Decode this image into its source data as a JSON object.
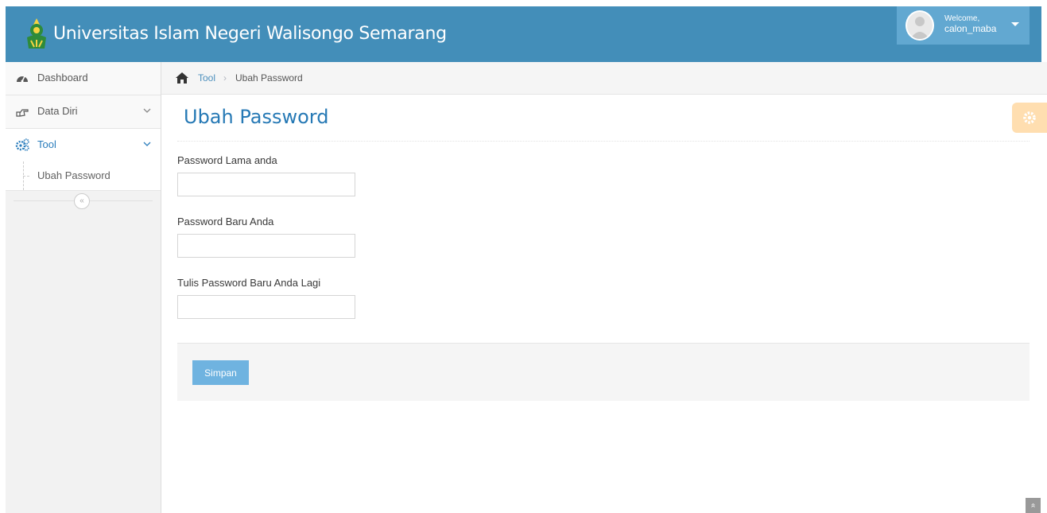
{
  "header": {
    "title": "Universitas Islam Negeri Walisongo Semarang",
    "welcome": "Welcome,",
    "username": "calon_maba"
  },
  "sidebar": {
    "items": [
      {
        "label": "Dashboard",
        "icon": "tachometer-icon"
      },
      {
        "label": "Data Diri",
        "icon": "hand-pointer-icon"
      },
      {
        "label": "Tool",
        "icon": "cogs-icon"
      }
    ],
    "submenu": [
      {
        "label": "Ubah Password"
      }
    ],
    "collapse_glyph": "«"
  },
  "breadcrumb": {
    "link": "Tool",
    "separator": "›",
    "current": "Ubah Password"
  },
  "page": {
    "title": "Ubah Password"
  },
  "form": {
    "old_password_label": "Password Lama anda",
    "new_password_label": "Password Baru Anda",
    "confirm_password_label": "Tulis Password Baru Anda Lagi",
    "old_password_value": "",
    "new_password_value": "",
    "confirm_password_value": "",
    "submit_label": "Simpan"
  },
  "scroll_up_glyph": "»",
  "colors": {
    "navbar": "#438eb9",
    "user_menu": "#62a8d1",
    "primary_button": "#6fb3e0",
    "title": "#2679b5",
    "settings": "#ffb752"
  }
}
